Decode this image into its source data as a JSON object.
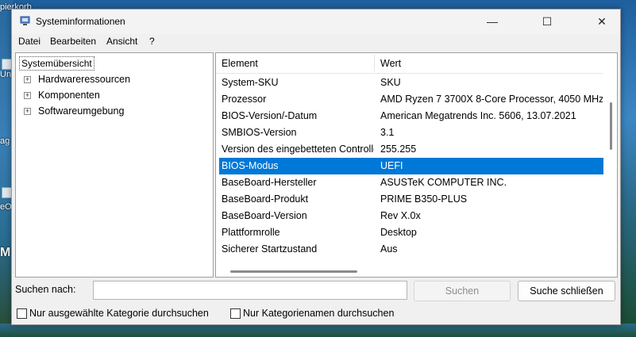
{
  "desktop": {
    "labels": [
      "pierkorb",
      "Uni",
      "ag",
      "eO",
      "M"
    ]
  },
  "window": {
    "title": "Systeminformationen",
    "controls": {
      "minimize": "—",
      "maximize": "☐",
      "close": "✕"
    }
  },
  "menu": [
    "Datei",
    "Bearbeiten",
    "Ansicht",
    "?"
  ],
  "tree": {
    "root": "Systemübersicht",
    "children": [
      "Hardwareressourcen",
      "Komponenten",
      "Softwareumgebung"
    ]
  },
  "list": {
    "columns": {
      "element": "Element",
      "value": "Wert"
    },
    "rows": [
      {
        "element": "System-SKU",
        "value": "SKU"
      },
      {
        "element": "Prozessor",
        "value": "AMD Ryzen 7 3700X 8-Core Processor, 4050 MHz"
      },
      {
        "element": "BIOS-Version/-Datum",
        "value": "American Megatrends Inc. 5606, 13.07.2021"
      },
      {
        "element": "SMBIOS-Version",
        "value": "3.1"
      },
      {
        "element": "Version des eingebetteten Controllers",
        "value": "255.255"
      },
      {
        "element": "BIOS-Modus",
        "value": "UEFI",
        "selected": true
      },
      {
        "element": "BaseBoard-Hersteller",
        "value": "ASUSTeK COMPUTER INC."
      },
      {
        "element": "BaseBoard-Produkt",
        "value": "PRIME B350-PLUS"
      },
      {
        "element": "BaseBoard-Version",
        "value": "Rev X.0x"
      },
      {
        "element": "Plattformrolle",
        "value": "Desktop"
      },
      {
        "element": "Sicherer Startzustand",
        "value": "Aus"
      }
    ]
  },
  "search": {
    "label": "Suchen nach:",
    "value": "",
    "search_button": "Suchen",
    "close_button": "Suche schließen",
    "check_selected_category": "Nur ausgewählte Kategorie durchsuchen",
    "check_category_names": "Nur Kategorienamen durchsuchen"
  },
  "colors": {
    "selection": "#0078d7",
    "window_bg": "#f0f0f0"
  }
}
